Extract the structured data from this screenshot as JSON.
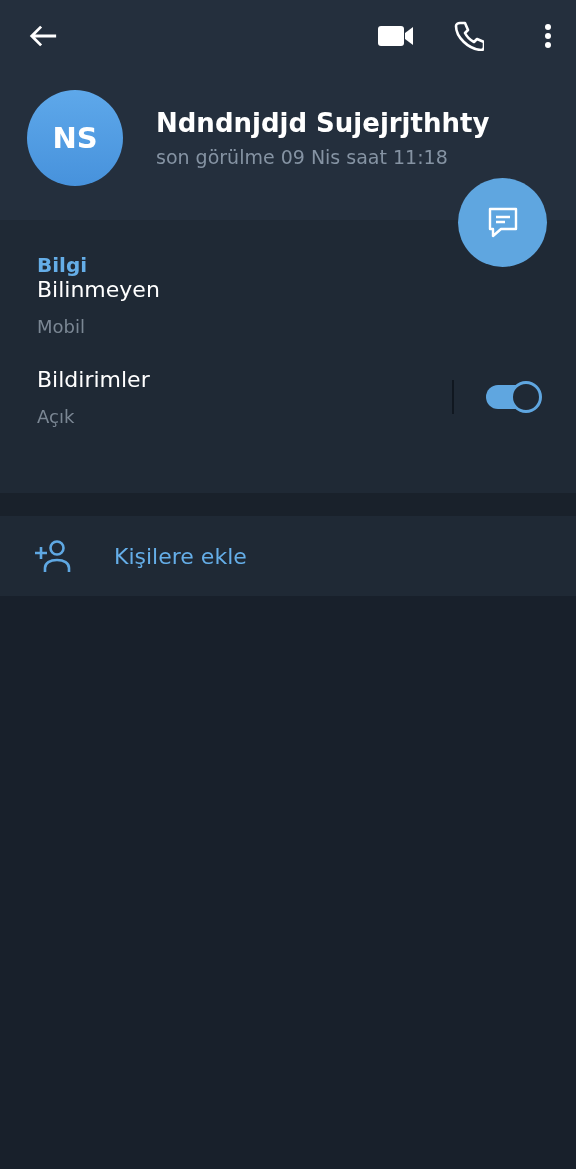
{
  "profile": {
    "initials": "NS",
    "name": "Ndndnjdjd Sujejrjthhty",
    "status": "son görülme 09 Nis saat 11:18"
  },
  "info": {
    "title": "Bilgi",
    "rows": [
      {
        "kind": "text",
        "value": "Bilinmeyen",
        "label": "Mobil"
      },
      {
        "kind": "toggle",
        "value": "Bildirimler",
        "label": "Açık",
        "on": true
      }
    ]
  },
  "actions": [
    {
      "label": "Kişilere ekle"
    }
  ]
}
